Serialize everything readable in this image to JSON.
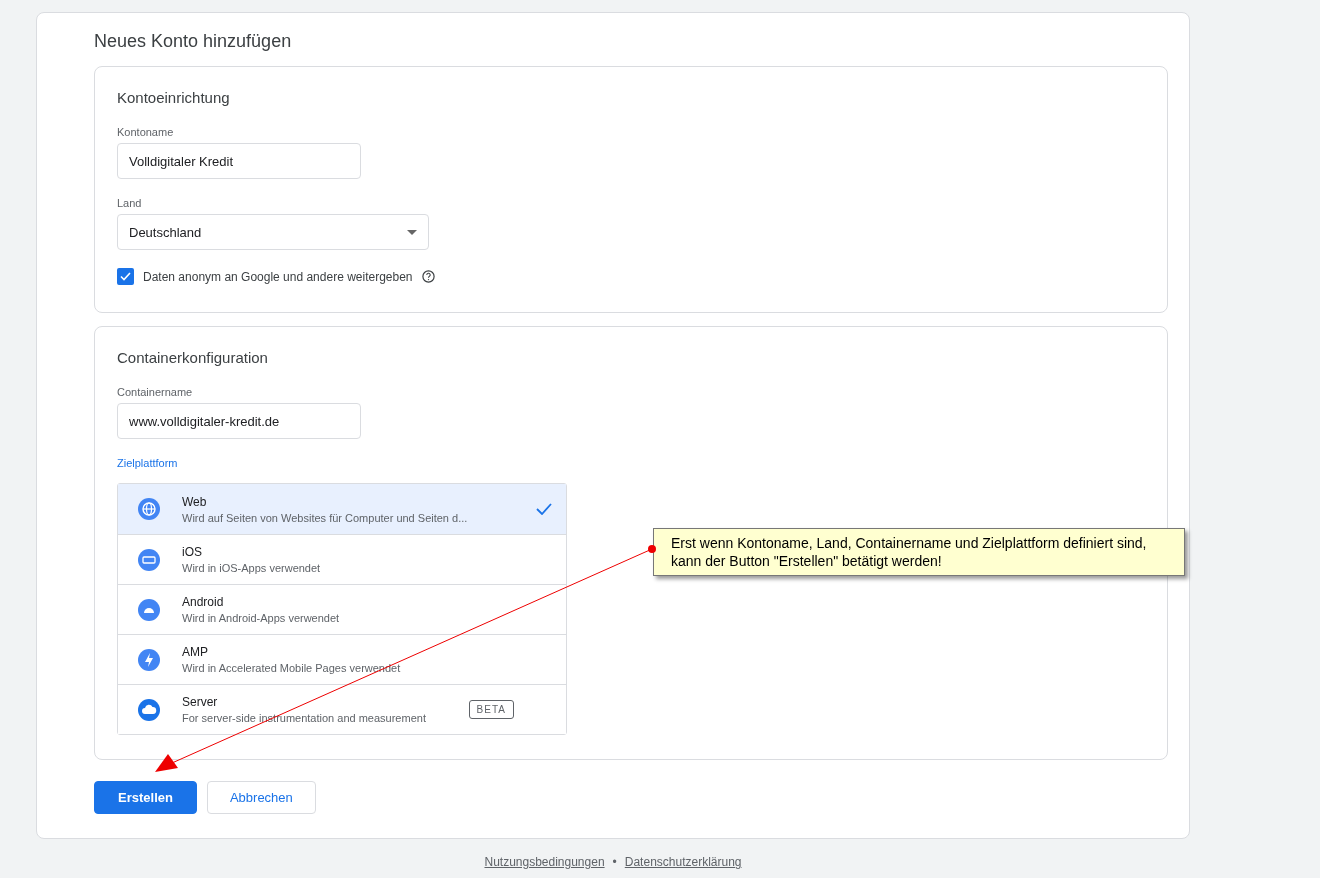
{
  "title": "Neues Konto hinzufügen",
  "account_setup": {
    "heading": "Kontoeinrichtung",
    "name_label": "Kontoname",
    "name_value": "Volldigitaler Kredit",
    "country_label": "Land",
    "country_value": "Deutschland",
    "share_label": "Daten anonym an Google und andere weitergeben",
    "share_checked": true
  },
  "container_setup": {
    "heading": "Containerkonfiguration",
    "name_label": "Containername",
    "name_value": "www.volldigitaler-kredit.de",
    "platform_label": "Zielplattform",
    "platforms": [
      {
        "kind": "web",
        "name": "Web",
        "description": "Wird auf Seiten von Websites für Computer und Seiten d...",
        "selected": true
      },
      {
        "kind": "ios",
        "name": "iOS",
        "description": "Wird in iOS-Apps verwendet",
        "selected": false
      },
      {
        "kind": "android",
        "name": "Android",
        "description": "Wird in Android-Apps verwendet",
        "selected": false
      },
      {
        "kind": "amp",
        "name": "AMP",
        "description": "Wird in Accelerated Mobile Pages verwendet",
        "selected": false
      },
      {
        "kind": "server",
        "name": "Server",
        "description": "For server-side instrumentation and measurement",
        "badge": "BETA",
        "selected": false
      }
    ]
  },
  "buttons": {
    "create": "Erstellen",
    "cancel": "Abbrechen"
  },
  "footer": {
    "links": [
      "Nutzungsbedingungen",
      "Datenschutzerklärung"
    ],
    "separator": "•"
  },
  "annotation": "Erst wenn Kontoname, Land, Containername und Zielplattform definiert sind, kann der Button \"Erstellen\" betätigt werden!"
}
